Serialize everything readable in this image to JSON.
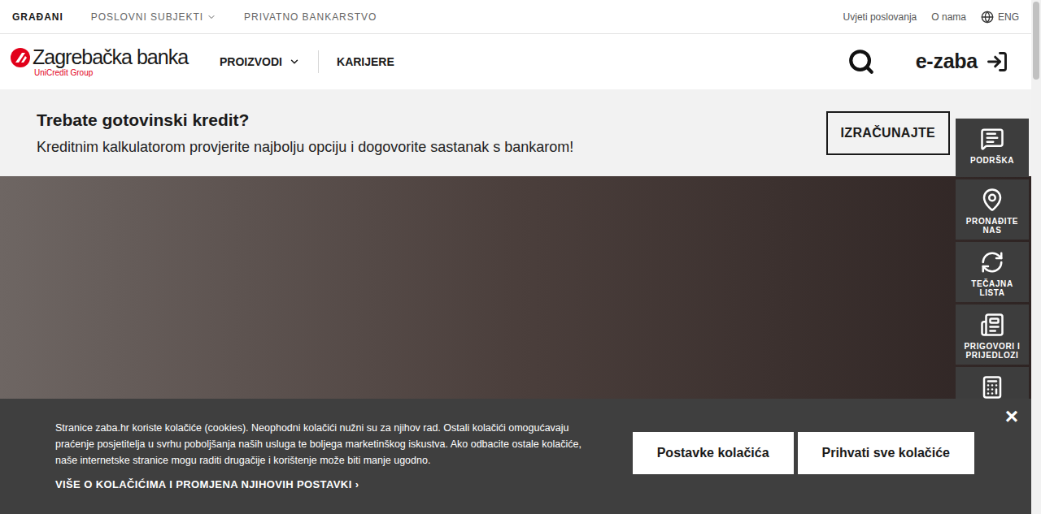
{
  "top_bar": {
    "segments": [
      {
        "label": "GRAĐANI",
        "selected": true,
        "dropdown": false
      },
      {
        "label": "POSLOVNI SUBJEKTI",
        "selected": false,
        "dropdown": true
      },
      {
        "label": "PRIVATNO BANKARSTVO",
        "selected": false,
        "dropdown": false
      }
    ],
    "links": [
      "Uvjeti poslovanja",
      "O nama"
    ],
    "language": "ENG"
  },
  "header": {
    "logo": {
      "name": "Zagrebačka banka",
      "group": "UniCredit Group"
    },
    "nav": [
      {
        "label": "PROIZVODI",
        "dropdown": true
      },
      {
        "label": "KARIJERE",
        "dropdown": false
      }
    ],
    "login": "e-zaba"
  },
  "promo": {
    "title": "Trebate gotovinski kredit?",
    "subtitle": "Kreditnim kalkulatorom provjerite najbolju opciju i dogovorite sastanak s bankarom!",
    "button": "IZRAČUNAJTE"
  },
  "side_tools": [
    {
      "label": "PODRŠKA"
    },
    {
      "label": "PRONAĐITE NAS"
    },
    {
      "label": "TEČAJNA LISTA"
    },
    {
      "label": "PRIGOVORI I PRIJEDLOZI"
    },
    {
      "label": ""
    }
  ],
  "cookie_banner": {
    "text": "Stranice zaba.hr koriste kolačiće (cookies). Neophodni kolačići nužni su za njihov rad. Ostali kolačići omogućavaju praćenje posjetitelja u svrhu poboljšanja naših usluga te boljega marketinškog iskustva. Ako odbacite ostale kolačiće, naše internetske stranice mogu raditi drugačije i korištenje može biti manje ugodno.",
    "link": "VIŠE O KOLAČIĆIMA I PROMJENA NJIHOVIH POSTAVKI",
    "link_icon": "›",
    "buttons": [
      "Postavke kolačića",
      "Prihvati sve kolačiće"
    ],
    "close": "×"
  }
}
